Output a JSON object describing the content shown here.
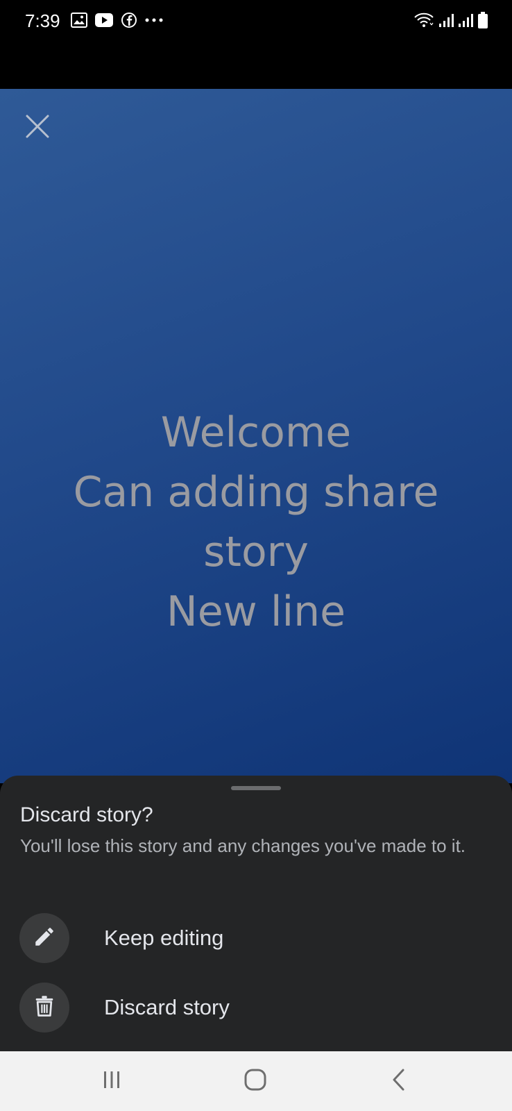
{
  "status_bar": {
    "time": "7:39",
    "left_icons": [
      "gallery-icon",
      "youtube-icon",
      "facebook-icon",
      "more-dots-icon"
    ],
    "right_icons": [
      "wifi-icon",
      "signal-icon",
      "signal-icon",
      "battery-icon"
    ]
  },
  "story": {
    "lines": [
      "Welcome",
      "Can adding share",
      "story",
      "New line"
    ],
    "background_colors": [
      "#2f5a97",
      "#0f3476"
    ],
    "text_color": "#9a9ba1"
  },
  "sheet": {
    "title": "Discard story?",
    "body": "You'll lose this story and any changes you've made to it.",
    "options": [
      {
        "label": "Keep editing",
        "icon": "pencil-icon"
      },
      {
        "label": "Discard story",
        "icon": "trash-icon"
      }
    ],
    "background_color": "#242526"
  },
  "nav_bar": {
    "buttons": [
      "recent-apps-icon",
      "home-icon",
      "back-icon"
    ]
  }
}
